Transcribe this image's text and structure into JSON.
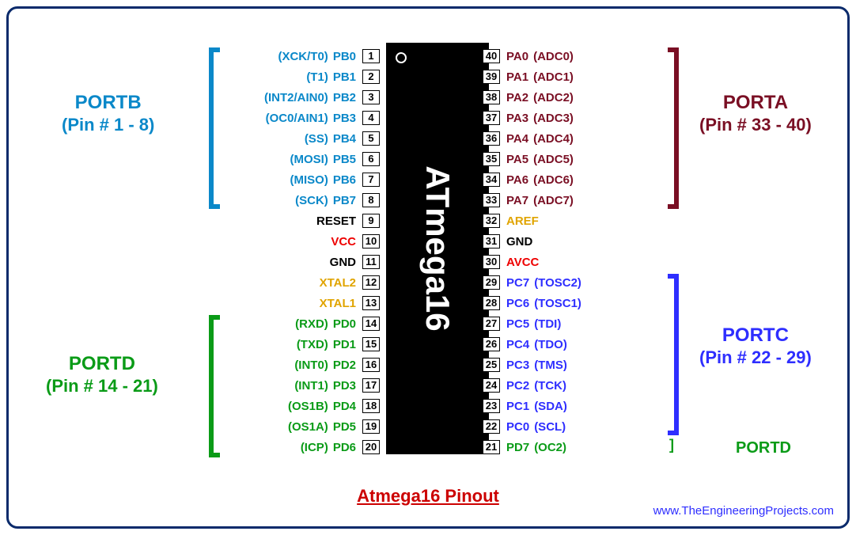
{
  "chip": {
    "name": "ATmega16"
  },
  "caption": "Atmega16 Pinout",
  "credit": "www.TheEngineeringProjects.com",
  "groups": {
    "portb": {
      "title": "PORTB",
      "sub": "(Pin # 1 - 8)"
    },
    "porta": {
      "title": "PORTA",
      "sub": "(Pin # 33 - 40)"
    },
    "portd": {
      "title": "PORTD",
      "sub": "(Pin # 14 - 21)"
    },
    "portc": {
      "title": "PORTC",
      "sub": "(Pin # 22 - 29)"
    },
    "portd_right": {
      "title": "PORTD"
    }
  },
  "left_pins": [
    {
      "num": "1",
      "port": "PB0",
      "func": "(XCK/T0)",
      "cls": "c-portb"
    },
    {
      "num": "2",
      "port": "PB1",
      "func": "(T1)",
      "cls": "c-portb"
    },
    {
      "num": "3",
      "port": "PB2",
      "func": "(INT2/AIN0)",
      "cls": "c-portb"
    },
    {
      "num": "4",
      "port": "PB3",
      "func": "(OC0/AIN1)",
      "cls": "c-portb"
    },
    {
      "num": "5",
      "port": "PB4",
      "func": "(SS)",
      "cls": "c-portb"
    },
    {
      "num": "6",
      "port": "PB5",
      "func": "(MOSI)",
      "cls": "c-portb"
    },
    {
      "num": "7",
      "port": "PB6",
      "func": "(MISO)",
      "cls": "c-portb"
    },
    {
      "num": "8",
      "port": "PB7",
      "func": "(SCK)",
      "cls": "c-portb"
    },
    {
      "num": "9",
      "port": "RESET",
      "func": "",
      "cls": "c-reset"
    },
    {
      "num": "10",
      "port": "VCC",
      "func": "",
      "cls": "c-vcc"
    },
    {
      "num": "11",
      "port": "GND",
      "func": "",
      "cls": "c-gnd"
    },
    {
      "num": "12",
      "port": "XTAL2",
      "func": "",
      "cls": "c-xtal"
    },
    {
      "num": "13",
      "port": "XTAL1",
      "func": "",
      "cls": "c-xtal"
    },
    {
      "num": "14",
      "port": "PD0",
      "func": "(RXD)",
      "cls": "c-portd"
    },
    {
      "num": "15",
      "port": "PD1",
      "func": "(TXD)",
      "cls": "c-portd"
    },
    {
      "num": "16",
      "port": "PD2",
      "func": "(INT0)",
      "cls": "c-portd"
    },
    {
      "num": "17",
      "port": "PD3",
      "func": "(INT1)",
      "cls": "c-portd"
    },
    {
      "num": "18",
      "port": "PD4",
      "func": "(OS1B)",
      "cls": "c-portd"
    },
    {
      "num": "19",
      "port": "PD5",
      "func": "(OS1A)",
      "cls": "c-portd"
    },
    {
      "num": "20",
      "port": "PD6",
      "func": "(ICP)",
      "cls": "c-portd"
    }
  ],
  "right_pins": [
    {
      "num": "40",
      "port": "PA0",
      "func": "(ADC0)",
      "cls": "c-porta"
    },
    {
      "num": "39",
      "port": "PA1",
      "func": "(ADC1)",
      "cls": "c-porta"
    },
    {
      "num": "38",
      "port": "PA2",
      "func": "(ADC2)",
      "cls": "c-porta"
    },
    {
      "num": "37",
      "port": "PA3",
      "func": "(ADC3)",
      "cls": "c-porta"
    },
    {
      "num": "36",
      "port": "PA4",
      "func": "(ADC4)",
      "cls": "c-porta"
    },
    {
      "num": "35",
      "port": "PA5",
      "func": "(ADC5)",
      "cls": "c-porta"
    },
    {
      "num": "34",
      "port": "PA6",
      "func": "(ADC6)",
      "cls": "c-porta"
    },
    {
      "num": "33",
      "port": "PA7",
      "func": "(ADC7)",
      "cls": "c-porta"
    },
    {
      "num": "32",
      "port": "AREF",
      "func": "",
      "cls": "c-aref"
    },
    {
      "num": "31",
      "port": "GND",
      "func": "",
      "cls": "c-gnd"
    },
    {
      "num": "30",
      "port": "AVCC",
      "func": "",
      "cls": "c-avcc"
    },
    {
      "num": "29",
      "port": "PC7",
      "func": "(TOSC2)",
      "cls": "c-portc"
    },
    {
      "num": "28",
      "port": "PC6",
      "func": "(TOSC1)",
      "cls": "c-portc"
    },
    {
      "num": "27",
      "port": "PC5",
      "func": "(TDI)",
      "cls": "c-portc"
    },
    {
      "num": "26",
      "port": "PC4",
      "func": "(TDO)",
      "cls": "c-portc"
    },
    {
      "num": "25",
      "port": "PC3",
      "func": "(TMS)",
      "cls": "c-portc"
    },
    {
      "num": "24",
      "port": "PC2",
      "func": "(TCK)",
      "cls": "c-portc"
    },
    {
      "num": "23",
      "port": "PC1",
      "func": "(SDA)",
      "cls": "c-portc"
    },
    {
      "num": "22",
      "port": "PC0",
      "func": "(SCL)",
      "cls": "c-portc"
    },
    {
      "num": "21",
      "port": "PD7",
      "func": "(OC2)",
      "cls": "c-portd"
    }
  ]
}
